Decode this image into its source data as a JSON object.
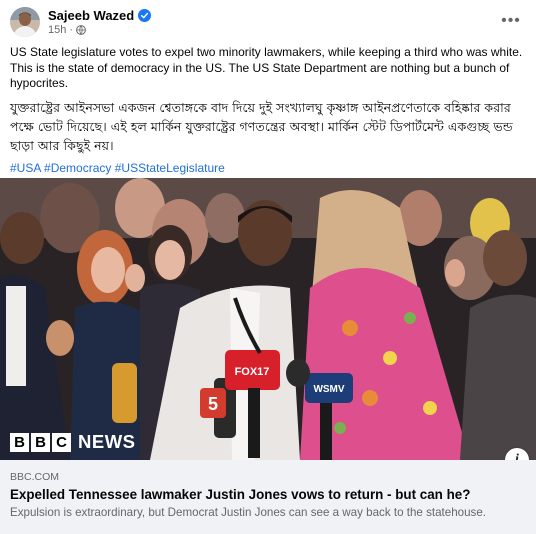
{
  "post": {
    "author": "Sajeeb Wazed",
    "time": "15h",
    "text_en": "US State legislature votes to expel two minority lawmakers, while keeping a third who was white. This is the state of democracy in the US. The US State Department are nothing but a bunch of hypocrites.",
    "text_bn": "যুক্তরাষ্ট্রের আইনসভা একজন শ্বেতাঙ্গকে বাদ দিয়ে দুই সংখ্যালঘু কৃষ্ণাঙ্গ আইনপ্রণেতাকে বহিষ্কার করার পক্ষে ভোট দিয়েছে। এই হল মার্কিন যুক্তরাষ্ট্রের গণতন্ত্রের অবস্থা। মার্কিন স্টেট ডিপার্টমেন্ট একগুচ্ছ ভন্ড ছাড়া আর কিছুই নয়।",
    "hashtags": [
      "#USA",
      "#Democracy",
      "#USStateLegislature"
    ]
  },
  "image": {
    "watermark_letters": [
      "B",
      "B",
      "C"
    ],
    "watermark_word": "NEWS",
    "mic_flags": [
      "5",
      "FOX17",
      "WSMV"
    ]
  },
  "link": {
    "domain": "BBC.COM",
    "title": "Expelled Tennessee lawmaker Justin Jones vows to return - but can he?",
    "description": "Expulsion is extraordinary, but Democrat Justin Jones can see a way back to the statehouse."
  },
  "colors": {
    "link_blue": "#216fdb",
    "verified_blue": "#1877f2",
    "secondary_text": "#65676b",
    "preview_bg": "#f0f2f5"
  },
  "icons": {
    "verified": "verified-badge-icon",
    "audience": "globe-icon",
    "menu": "more-options-icon",
    "info": "info-icon"
  }
}
